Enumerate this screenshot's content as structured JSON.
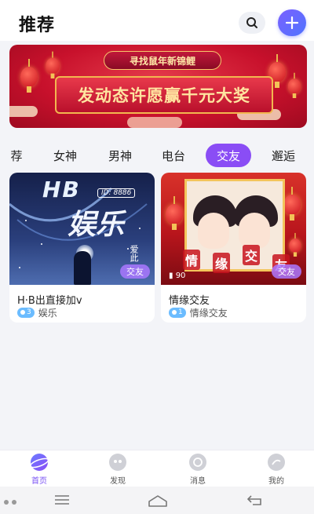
{
  "header": {
    "title": "推荐",
    "search_icon": "search-icon",
    "add_icon": "plus-icon"
  },
  "banner": {
    "headline": "寻找鼠年新锦鲤",
    "slogan": "发动态许愿赢千元大奖",
    "page_indicator": {
      "count": 2,
      "active": 1
    }
  },
  "tabs": [
    {
      "label": "荐",
      "active": false
    },
    {
      "label": "女神",
      "active": false
    },
    {
      "label": "男神",
      "active": false
    },
    {
      "label": "电台",
      "active": false
    },
    {
      "label": "交友",
      "active": true
    },
    {
      "label": "邂逅",
      "active": false
    }
  ],
  "cards": [
    {
      "title": "H·B出直接加v",
      "online_count": "3",
      "category": "娱乐",
      "tag": "交友",
      "art_title": "HB",
      "art_id": "ID: 8886",
      "art_subtitle": "娱乐",
      "art_side": "爱此"
    },
    {
      "title": "情缘交友",
      "online_count": "1",
      "category": "情缘交友",
      "tag": "交友",
      "art_badge": "90",
      "art_chars": [
        "情",
        "缘",
        "交",
        "友"
      ]
    }
  ],
  "bottom_nav": [
    {
      "label": "首页",
      "icon": "planet-icon",
      "active": true
    },
    {
      "label": "发现",
      "icon": "discover-icon",
      "active": false
    },
    {
      "label": "消息",
      "icon": "chat-icon",
      "active": false
    },
    {
      "label": "我的",
      "icon": "profile-icon",
      "active": false
    }
  ],
  "colors": {
    "accent": "#8a4df5",
    "tag_bg": "#a978ff",
    "pill_bg": "#6bbcff",
    "banner_red": "#c8112c",
    "banner_gold": "#f2b74f"
  }
}
